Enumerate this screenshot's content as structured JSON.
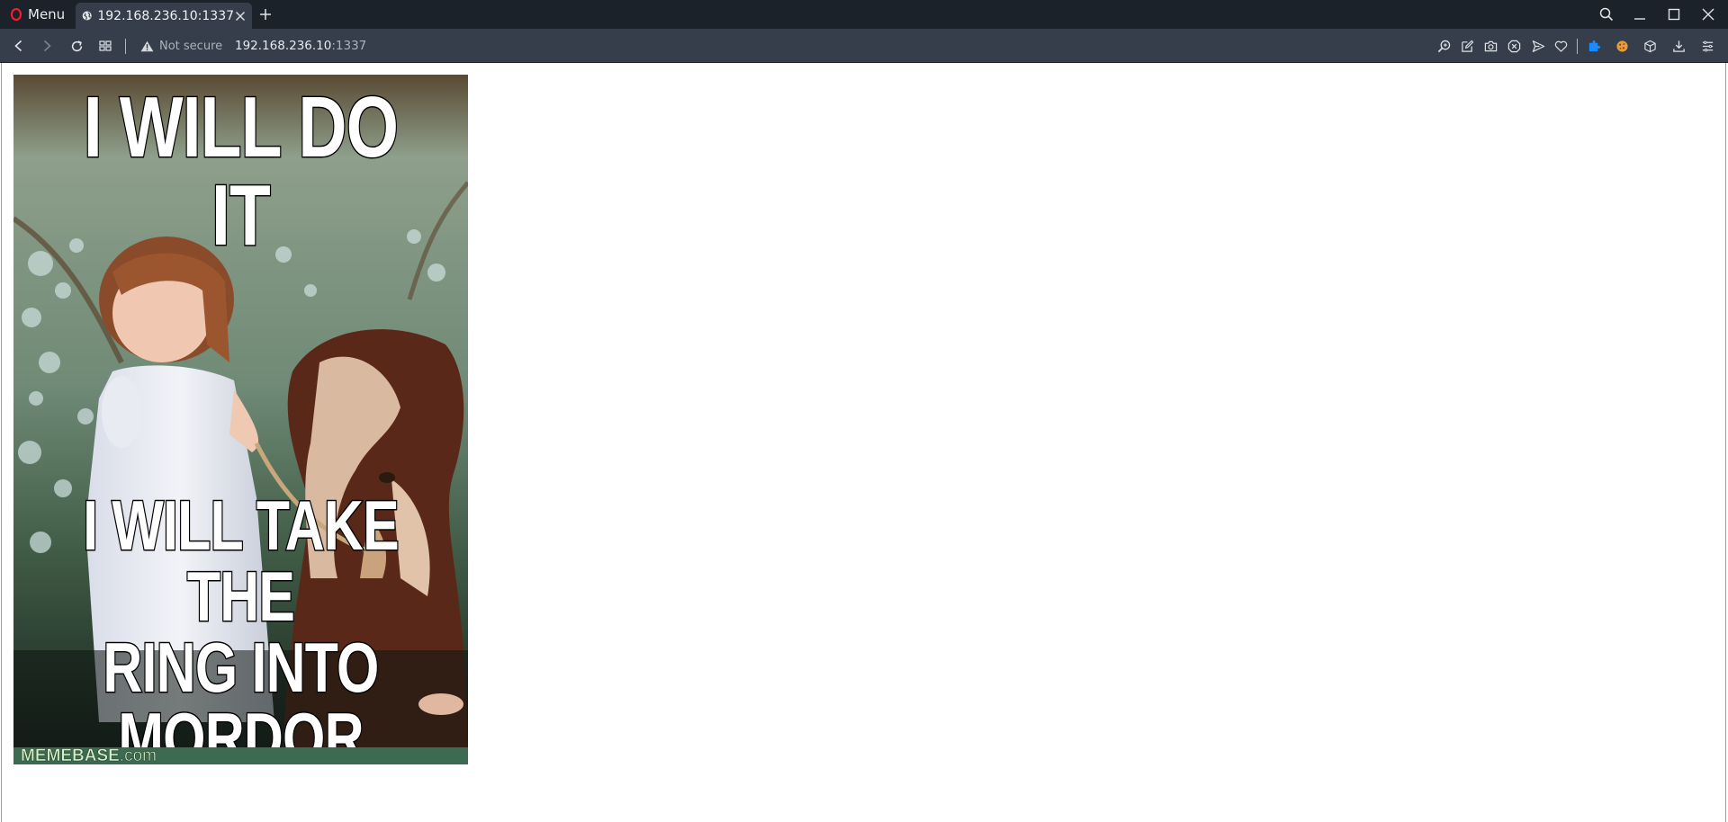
{
  "browser": {
    "menu_label": "Menu",
    "tab": {
      "title": "192.168.236.10:1337"
    },
    "address_bar": {
      "security_label": "Not secure",
      "url_host": "192.168.236.10",
      "url_port": ":1337"
    },
    "icons": {
      "back": "chevron-left-icon",
      "forward": "chevron-right-icon",
      "reload": "reload-icon",
      "tab-grid": "grid-icon",
      "search": "search-icon",
      "minimize": "minimize-icon",
      "maximize": "maximize-icon",
      "close": "close-icon",
      "toolbar_right": [
        "zoom-icon",
        "edit-icon",
        "camera-icon",
        "block-icon",
        "send-icon",
        "heart-icon",
        "extension-icon",
        "cookie-icon",
        "box-icon",
        "download-icon",
        "menu-lines-icon"
      ]
    },
    "colors": {
      "tabbar_bg": "#1b222a",
      "toolbar_bg": "#353e4a",
      "opera_red": "#ff1b2d",
      "extension_blue": "#1a8cff",
      "cookie_orange": "#e99a3a"
    }
  },
  "page": {
    "meme": {
      "top_text": "I WILL DO IT",
      "bottom_text_lines": [
        "I WILL TAKE THE",
        "RING INTO",
        "MORDOR"
      ],
      "watermark_main": "MEMEBASE",
      "watermark_suffix": ".com"
    }
  }
}
